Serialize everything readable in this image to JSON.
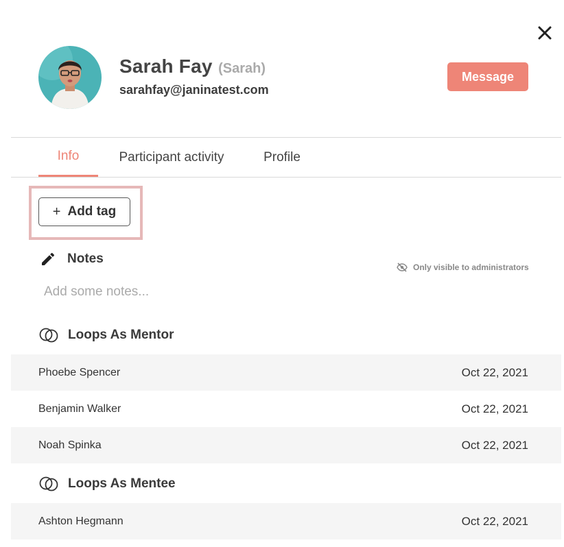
{
  "profile": {
    "name": "Sarah Fay",
    "nickname": "(Sarah)",
    "email": "sarahfay@janinatest.com",
    "message_label": "Message"
  },
  "tabs": [
    {
      "label": "Info",
      "active": true
    },
    {
      "label": "Participant activity",
      "active": false
    },
    {
      "label": "Profile",
      "active": false
    }
  ],
  "tags": {
    "add_label": "Add tag",
    "plus": "+"
  },
  "notes": {
    "title": "Notes",
    "visibility": "Only visible to administrators",
    "placeholder": "Add some notes..."
  },
  "loops_mentor": {
    "title": "Loops As Mentor",
    "rows": [
      {
        "name": "Phoebe Spencer",
        "date": "Oct 22, 2021"
      },
      {
        "name": "Benjamin Walker",
        "date": "Oct 22, 2021"
      },
      {
        "name": "Noah Spinka",
        "date": "Oct 22, 2021"
      }
    ]
  },
  "loops_mentee": {
    "title": "Loops As Mentee",
    "rows": [
      {
        "name": "Ashton Hegmann",
        "date": "Oct 22, 2021"
      }
    ]
  },
  "colors": {
    "accent": "#ee8577",
    "highlight": "#e6b8b8",
    "row_shade": "#f5f5f5"
  },
  "icons": [
    "close-icon",
    "avatar-photo",
    "plus-icon",
    "pencil-icon",
    "eye-slash-icon",
    "loops-icon"
  ]
}
